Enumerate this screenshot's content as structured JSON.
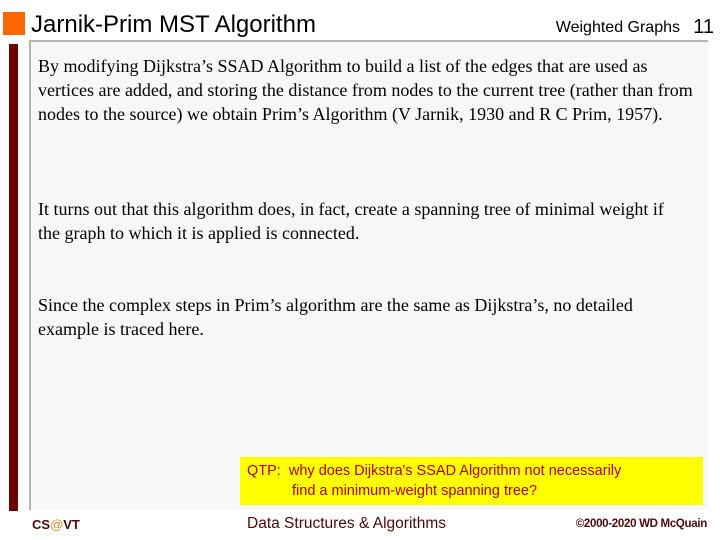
{
  "header": {
    "title": "Jarnik-Prim MST Algorithm",
    "section": "Weighted Graphs",
    "slide_number": "11"
  },
  "content": {
    "paragraphs": [
      "By modifying Dijkstra’s SSAD Algorithm to build a list of the edges that are used as vertices are added, and storing the distance from nodes to the current tree (rather than from nodes to the source) we obtain Prim’s Algorithm (V Jarnik, 1930 and R C Prim, 1957).",
      "It turns out that this algorithm does, in fact, create a spanning tree of minimal weight if the graph to which it is applied is connected.",
      "Since the complex steps in Prim’s algorithm are the same as Dijkstra’s, no detailed example is traced here."
    ],
    "qtp": {
      "line1": "QTP:  why does Dijkstra's SSAD Algorithm not necessarily",
      "line2": "find a minimum-weight spanning tree?"
    }
  },
  "footer": {
    "left_prefix": "CS",
    "left_at": "@",
    "left_suffix": "VT",
    "center": "Data Structures & Algorithms",
    "right": "©2000-2020 WD McQuain"
  },
  "colors": {
    "title_marker": "#ff6600",
    "side_bar": "#6e0000",
    "qtp_background": "#ffff00",
    "qtp_text": "#b00000",
    "footer_text": "#4a0a0a",
    "footer_at": "#e08a2e"
  }
}
